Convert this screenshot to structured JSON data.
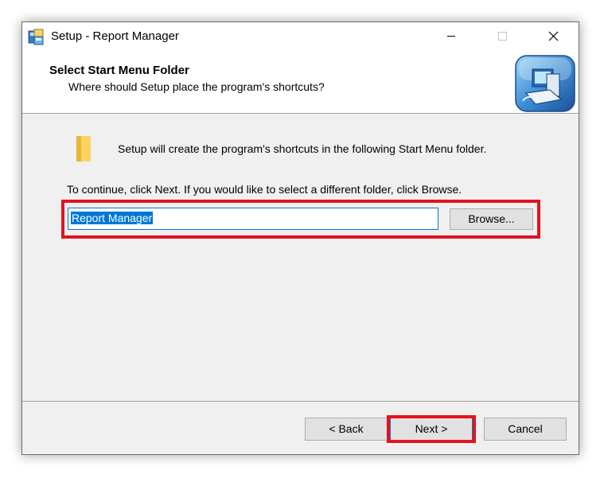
{
  "window": {
    "title": "Setup - Report Manager",
    "controls": {
      "minimize": "minimize",
      "maximize": "maximize",
      "close": "close"
    }
  },
  "header": {
    "title": "Select Start Menu Folder",
    "subtitle": "Where should Setup place the program's shortcuts?"
  },
  "body": {
    "intro": "Setup will create the program's shortcuts in the following Start Menu folder.",
    "instruction": "To continue, click Next. If you would like to select a different folder, click Browse.",
    "folder_value": "Report Manager",
    "browse_label": "Browse..."
  },
  "footer": {
    "back_label": "< Back",
    "next_label": "Next >",
    "cancel_label": "Cancel"
  },
  "colors": {
    "highlight": "#e3131f",
    "selection": "#0078d7",
    "dialog_bg": "#f0f0f0"
  },
  "icons": [
    "setup-app-icon",
    "computer-wizard-icon",
    "folder-icon",
    "minimize-icon",
    "maximize-icon",
    "close-icon"
  ]
}
